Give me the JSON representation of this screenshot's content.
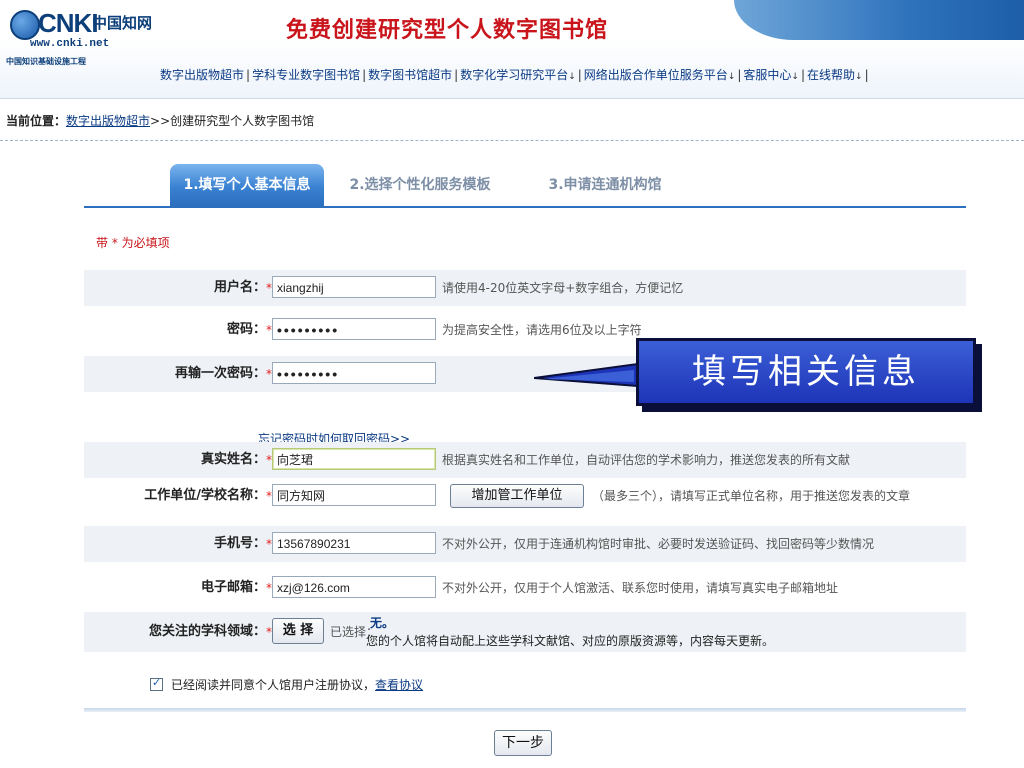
{
  "header": {
    "logo": {
      "brand": "CNKI",
      "brand_cn": "中国知网",
      "url": "www.cnki.net",
      "subtitle": "中国知识基础设施工程"
    },
    "title": "免费创建研究型个人数字图书馆",
    "nav": [
      {
        "label": "数字出版物超市"
      },
      {
        "label": "学科专业数字图书馆"
      },
      {
        "label": "数字图书馆超市"
      },
      {
        "label": "数字化学习研究平台"
      },
      {
        "label": "网络出版合作单位服务平台"
      },
      {
        "label": "客服中心"
      },
      {
        "label": "在线帮助"
      }
    ],
    "nav_caret": "↓"
  },
  "breadcrumb": {
    "label": "当前位置：",
    "link": "数字出版物超市",
    "sep": ">>",
    "current": "创建研究型个人数字图书馆"
  },
  "tabs": [
    {
      "label": "1.填写个人基本信息",
      "active": true
    },
    {
      "label": "2.选择个性化服务模板",
      "active": false
    },
    {
      "label": "3.申请连通机构馆",
      "active": false
    }
  ],
  "required_note": "带 * 为必填项",
  "star": "*",
  "form": {
    "username": {
      "label": "用户名：",
      "value": "xiangzhij",
      "hint": "请使用4-20位英文字母+数字组合，方便记忆"
    },
    "password": {
      "label": "密码：",
      "value": "•••••••••",
      "hint": "为提高安全性，请选用6位及以上字符"
    },
    "password2": {
      "label": "再输一次密码：",
      "value": "•••••••••"
    },
    "forgot_link": "忘记密码时如何取回密码>>",
    "realname": {
      "label": "真实姓名：",
      "value": "向芝珺",
      "hint": "根据真实姓名和工作单位，自动评估您的学术影响力，推送您发表的所有文献"
    },
    "org": {
      "label": "工作单位/学校名称：",
      "value": "同方知网",
      "button": "增加管工作单位",
      "hint": "（最多三个），请填写正式单位名称，用于推送您发表的文章"
    },
    "phone": {
      "label": "手机号：",
      "value": "13567890231",
      "hint": "不对外公开，仅用于连通机构馆时审批、必要时发送验证码、找回密码等少数情况"
    },
    "email": {
      "label": "电子邮箱：",
      "value": "xzj@126.com",
      "hint": "不对外公开，仅用于个人馆激活、联系您时使用，请填写真实电子邮箱地址"
    },
    "subject": {
      "label": "您关注的学科领域：",
      "button": "选 择",
      "selected_label": "已选择：",
      "selected_value": "无。",
      "desc": "您的个人馆将自动配上这些学科文献馆、对应的原版资源等，内容每天更新。"
    }
  },
  "agreement": {
    "text": "已经阅读并同意个人馆用户注册协议，",
    "link": "查看协议",
    "checked": true
  },
  "next_button": "下一步",
  "callout": {
    "text": "填写相关信息"
  }
}
